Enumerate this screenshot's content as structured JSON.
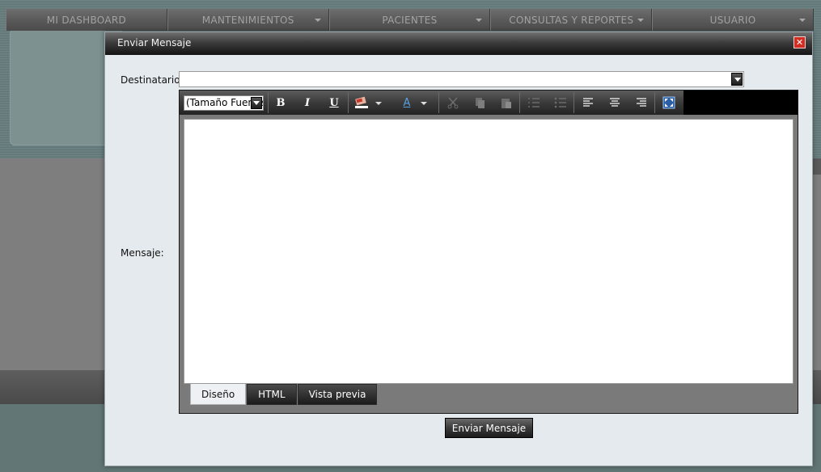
{
  "nav": {
    "items": [
      {
        "label": "MI DASHBOARD",
        "has_dropdown": false
      },
      {
        "label": "MANTENIMIENTOS",
        "has_dropdown": true
      },
      {
        "label": "PACIENTES",
        "has_dropdown": true
      },
      {
        "label": "CONSULTAS Y REPORTES",
        "has_dropdown": true
      },
      {
        "label": "USUARIO",
        "has_dropdown": true
      }
    ]
  },
  "dialog": {
    "title": "Enviar Mensaje",
    "close_icon": "close-icon",
    "recipient_label": "Destinatario:",
    "recipient_value": "",
    "message_label": "Mensaje:",
    "editor": {
      "font_size_value": "(Tamaño Fuente)",
      "toolbar": [
        "bold-icon",
        "italic-icon",
        "underline-icon",
        "highlight-color-icon",
        "font-color-icon",
        "cut-icon",
        "copy-icon",
        "paste-icon",
        "ordered-list-icon",
        "unordered-list-icon",
        "align-left-icon",
        "align-center-icon",
        "align-right-icon",
        "fullscreen-icon"
      ],
      "bold_glyph": "B",
      "italic_glyph": "I",
      "underline_glyph": "U",
      "font_color_glyph": "A",
      "tabs": [
        {
          "label": "Diseño",
          "active": true
        },
        {
          "label": "HTML",
          "active": false
        },
        {
          "label": "Vista previa",
          "active": false
        }
      ]
    },
    "send_label": "Enviar Mensaje"
  }
}
